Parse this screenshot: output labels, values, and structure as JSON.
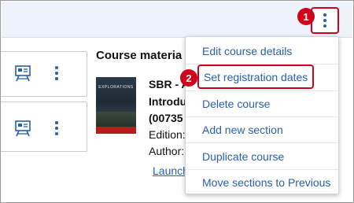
{
  "header": {
    "kebab_icon": "more-vertical-icon",
    "step1": "1"
  },
  "section_cards": [
    {
      "icon": "assignment-icon",
      "kebab_icon": "more-vertical-icon"
    },
    {
      "icon": "assignment-icon",
      "kebab_icon": "more-vertical-icon"
    }
  ],
  "course_materials": {
    "title": "Course materia",
    "cover_label": "EXPLORATIONS",
    "lines": [
      "SBR - A",
      "Introdu",
      "(00735",
      "Edition:",
      "Author:"
    ],
    "launch_link": "Launch"
  },
  "menu": {
    "items": [
      "Edit course details",
      "Set registration dates",
      "Delete course",
      "Add new section",
      "Duplicate course",
      "Move sections to Previous"
    ],
    "highlighted_index": 1,
    "step2": "2"
  },
  "colors": {
    "accent_blue": "#2a61a8",
    "callout_red": "#d0021b"
  }
}
